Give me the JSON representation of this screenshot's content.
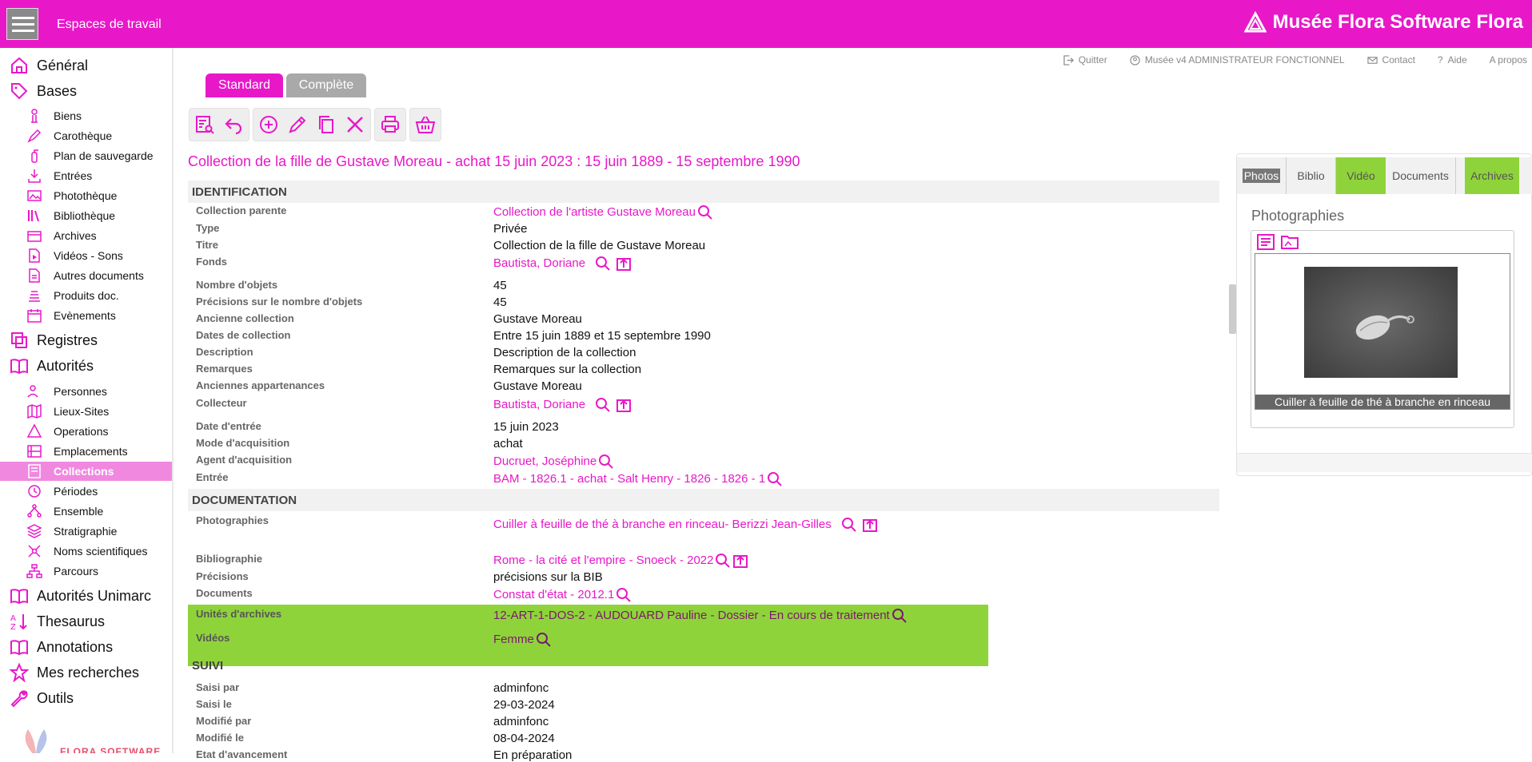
{
  "topbar": {
    "workspaces_label": "Espaces de travail",
    "brand": "Musée Flora Software Flora"
  },
  "sidebar": {
    "general": "Général",
    "bases": "Bases",
    "bases_items": [
      "Biens",
      "Carothèque",
      "Plan de sauvegarde",
      "Entrées",
      "Photothèque",
      "Bibliothèque",
      "Archives",
      "Vidéos - Sons",
      "Autres documents",
      "Produits doc.",
      "Evènements"
    ],
    "registres": "Registres",
    "autorites": "Autorités",
    "autorites_items": [
      "Personnes",
      "Lieux-Sites",
      "Operations",
      "Emplacements",
      "Collections",
      "Périodes",
      "Ensemble",
      "Stratigraphie",
      "Noms scientifiques",
      "Parcours"
    ],
    "active_item": "Collections",
    "autorites_unimarc": "Autorités Unimarc",
    "thesaurus": "Thesaurus",
    "annotations": "Annotations",
    "mes_recherches": "Mes recherches",
    "outils": "Outils",
    "logo_text": "FLORA SOFTWARE"
  },
  "utility": {
    "quit": "Quitter",
    "user": "Musée v4 ADMINISTRATEUR FONCTIONNEL",
    "contact": "Contact",
    "help": "Aide",
    "about": "A propos"
  },
  "tabs": {
    "standard": "Standard",
    "complete": "Complète"
  },
  "record_title": "Collection de la fille de Gustave Moreau - achat 15 juin 2023 : 15 juin 1889 - 15 septembre 1990",
  "sections": {
    "identification": "IDENTIFICATION",
    "documentation": "DOCUMENTATION",
    "suivi": "SUIVI"
  },
  "fields": {
    "collection_parente": {
      "label": "Collection parente",
      "value": "Collection de l'artiste Gustave Moreau"
    },
    "type": {
      "label": "Type",
      "value": "Privée"
    },
    "titre": {
      "label": "Titre",
      "value": "Collection de la fille de Gustave Moreau"
    },
    "fonds": {
      "label": "Fonds",
      "value": "Bautista, Doriane"
    },
    "nombre_objets": {
      "label": "Nombre d'objets",
      "value": "45"
    },
    "precisions_nombre": {
      "label": "Précisions sur le nombre d'objets",
      "value": "45"
    },
    "ancienne_collection": {
      "label": "Ancienne collection",
      "value": "Gustave Moreau"
    },
    "dates_collection": {
      "label": "Dates de collection",
      "value": "Entre 15 juin 1889 et 15 septembre 1990"
    },
    "description": {
      "label": "Description",
      "value": "Description de la collection"
    },
    "remarques": {
      "label": "Remarques",
      "value": "Remarques sur la collection"
    },
    "anciennes_appartenances": {
      "label": "Anciennes appartenances",
      "value": "Gustave Moreau"
    },
    "collecteur": {
      "label": "Collecteur",
      "value": "Bautista, Doriane"
    },
    "date_entree": {
      "label": "Date d'entrée",
      "value": "15 juin 2023"
    },
    "mode_acquisition": {
      "label": "Mode d'acquisition",
      "value": "achat"
    },
    "agent_acquisition": {
      "label": "Agent d'acquisition",
      "value": "Ducruet, Joséphine"
    },
    "entree": {
      "label": "Entrée",
      "value": "BAM - 1826.1 - achat - Salt Henry - 1826 - 1826 - 1"
    },
    "photographies": {
      "label": "Photographies",
      "value": "Cuiller à feuille de thé à branche en rinceau- Berizzi Jean-Gilles"
    },
    "bibliographie": {
      "label": "Bibliographie",
      "value": "Rome - la cité et l'empire - Snoeck - 2022"
    },
    "precisions": {
      "label": "Précisions",
      "value": "précisions sur la BIB"
    },
    "documents": {
      "label": "Documents",
      "value": "Constat d'état - 2012.1"
    },
    "unites_archives": {
      "label": "Unités d'archives",
      "value": "12-ART-1-DOS-2 - AUDOUARD Pauline - Dossier - En cours de traitement"
    },
    "videos": {
      "label": "Vidéos",
      "value": "Femme"
    },
    "saisi_par": {
      "label": "Saisi par",
      "value": "adminfonc"
    },
    "saisi_le": {
      "label": "Saisi le",
      "value": "29-03-2024"
    },
    "modifie_par": {
      "label": "Modifié par",
      "value": "adminfonc"
    },
    "modifie_le": {
      "label": "Modifié le",
      "value": "08-04-2024"
    },
    "etat_avancement": {
      "label": "Etat d'avancement",
      "value": "En préparation"
    }
  },
  "right_panel": {
    "tabs": [
      "Photos",
      "Biblio",
      "Vidéo",
      "Documents",
      "Archives"
    ],
    "heading": "Photographies",
    "photo_caption": "Cuiller à feuille de thé à branche en rinceau"
  },
  "colors": {
    "accent": "#e818c9",
    "highlight": "#8fd33b",
    "active_nav": "#f088e0"
  }
}
